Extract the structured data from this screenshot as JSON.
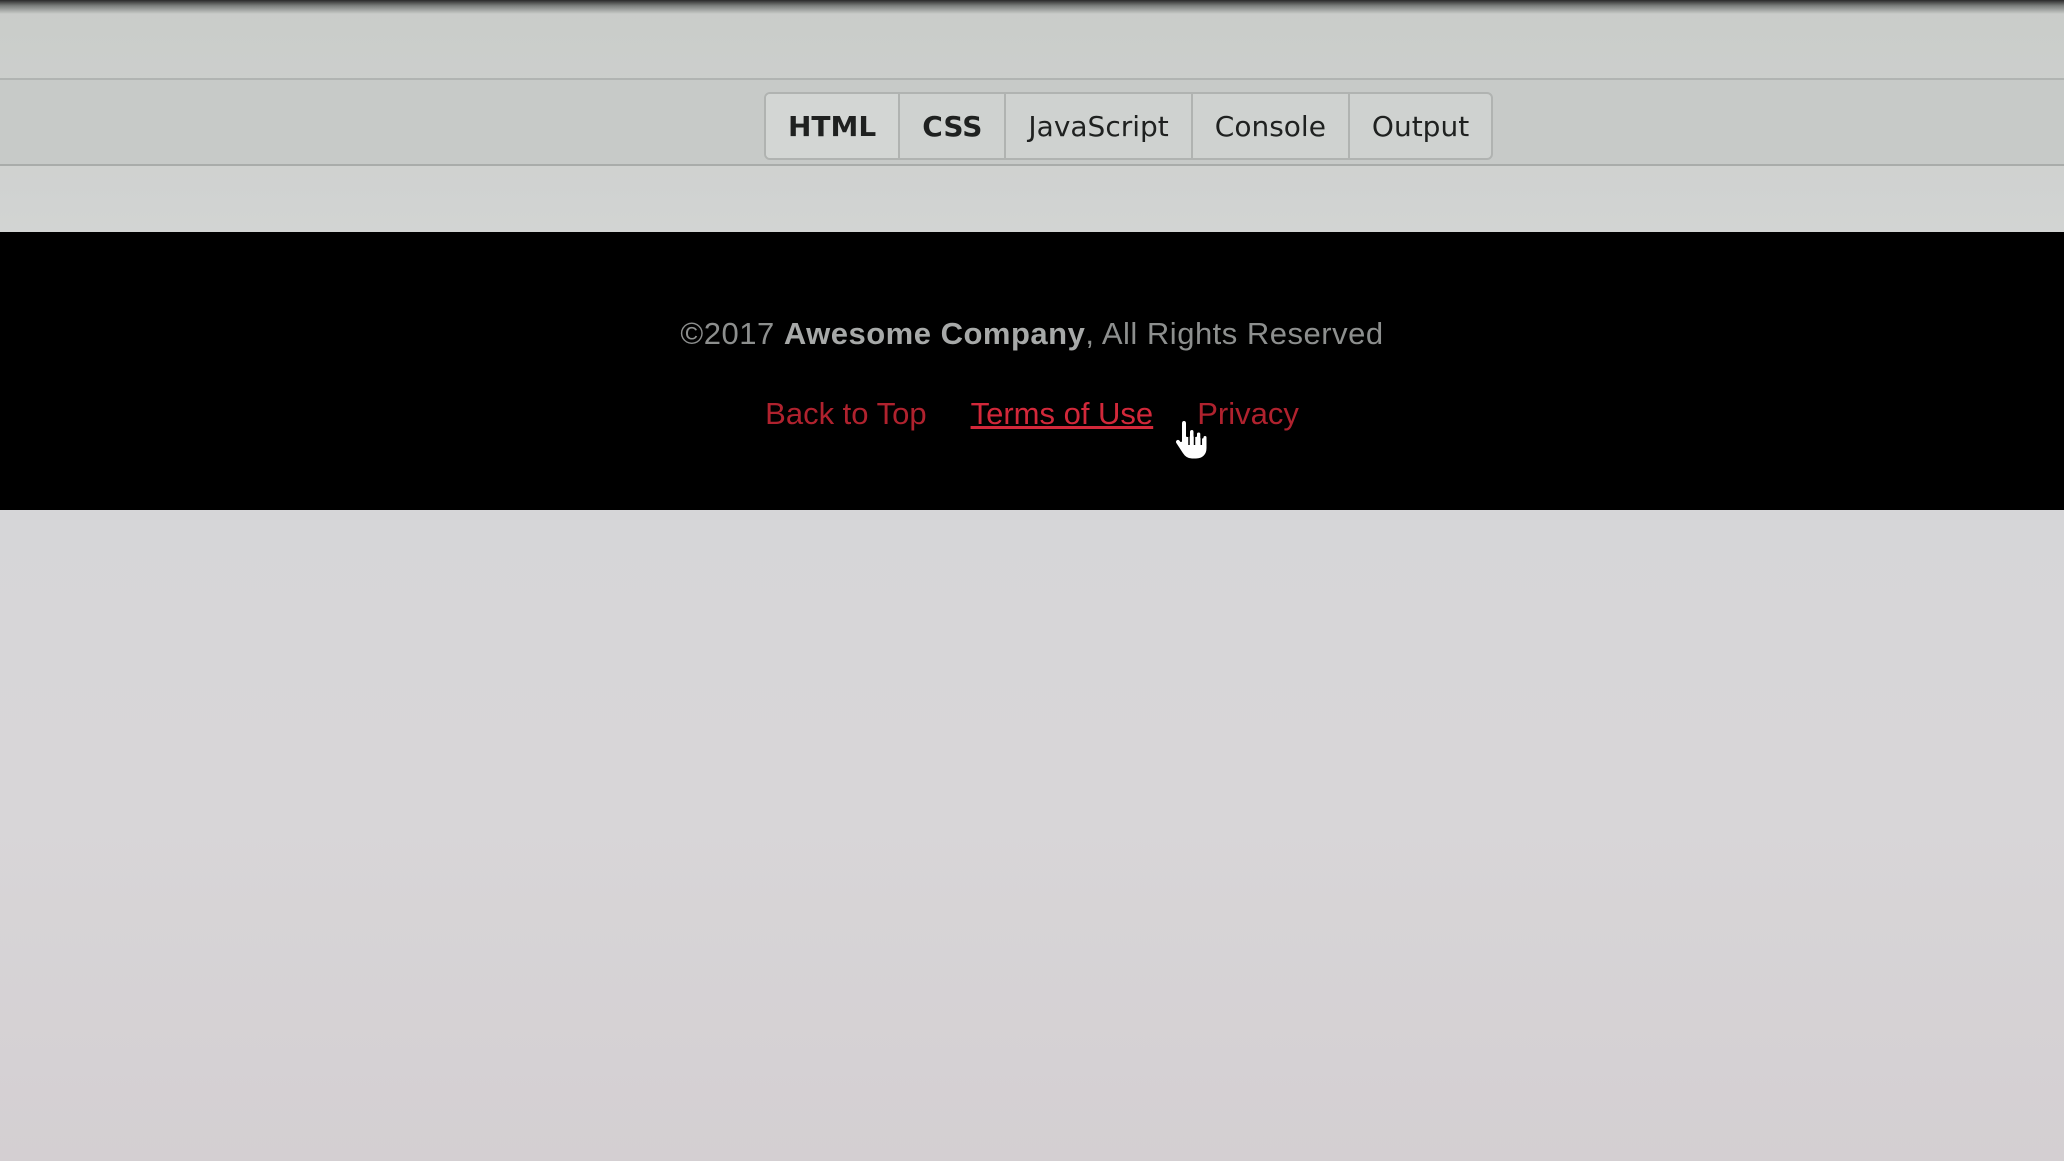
{
  "tabs": [
    {
      "label": "HTML",
      "active": true
    },
    {
      "label": "CSS",
      "active": false
    },
    {
      "label": "JavaScript",
      "active": false
    },
    {
      "label": "Console",
      "active": false
    },
    {
      "label": "Output",
      "active": false
    }
  ],
  "footer": {
    "copyright_prefix": "©2017 ",
    "company": "Awesome Company",
    "copyright_suffix": ", All Rights Reserved",
    "links": {
      "back_to_top": "Back to Top",
      "terms": "Terms of Use",
      "privacy": "Privacy"
    }
  },
  "colors": {
    "footer_bg": "#000000",
    "link": "#b0222e",
    "link_hover": "#d2283a"
  },
  "icons": {
    "cursor": "hand-pointer-icon"
  }
}
